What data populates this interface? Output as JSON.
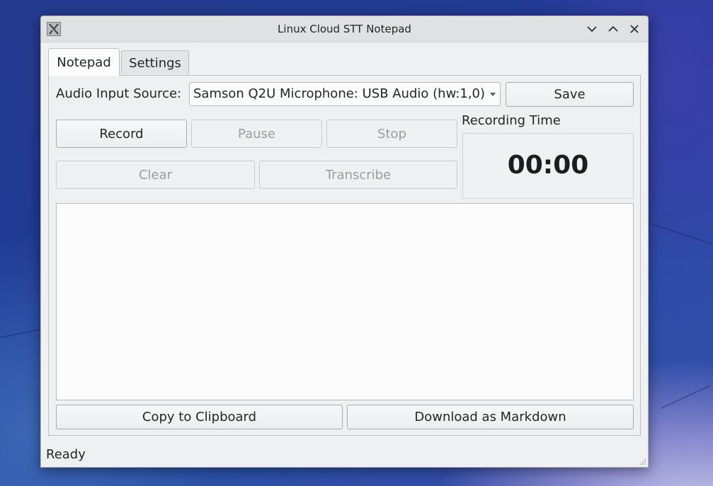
{
  "window": {
    "title": "Linux Cloud STT Notepad"
  },
  "tabs": [
    {
      "label": "Notepad",
      "active": true
    },
    {
      "label": "Settings",
      "active": false
    }
  ],
  "audio": {
    "label": "Audio Input Source:",
    "selected": "Samson Q2U Microphone: USB Audio (hw:1,0)"
  },
  "buttons": {
    "save": "Save",
    "record": "Record",
    "pause": "Pause",
    "stop": "Stop",
    "clear": "Clear",
    "transcribe": "Transcribe",
    "copy": "Copy to Clipboard",
    "download": "Download as Markdown"
  },
  "recording": {
    "label": "Recording Time",
    "time": "00:00"
  },
  "transcript": {
    "text": ""
  },
  "status": {
    "text": "Ready"
  },
  "colors": {
    "window_bg": "#eff0f1",
    "titlebar_bg": "#dfe1e3",
    "disabled_text": "#9a9c9e"
  },
  "icons": {
    "app": "x-app-icon",
    "minimize": "chevron-down-icon",
    "maximize": "chevron-up-icon",
    "close": "close-icon"
  }
}
